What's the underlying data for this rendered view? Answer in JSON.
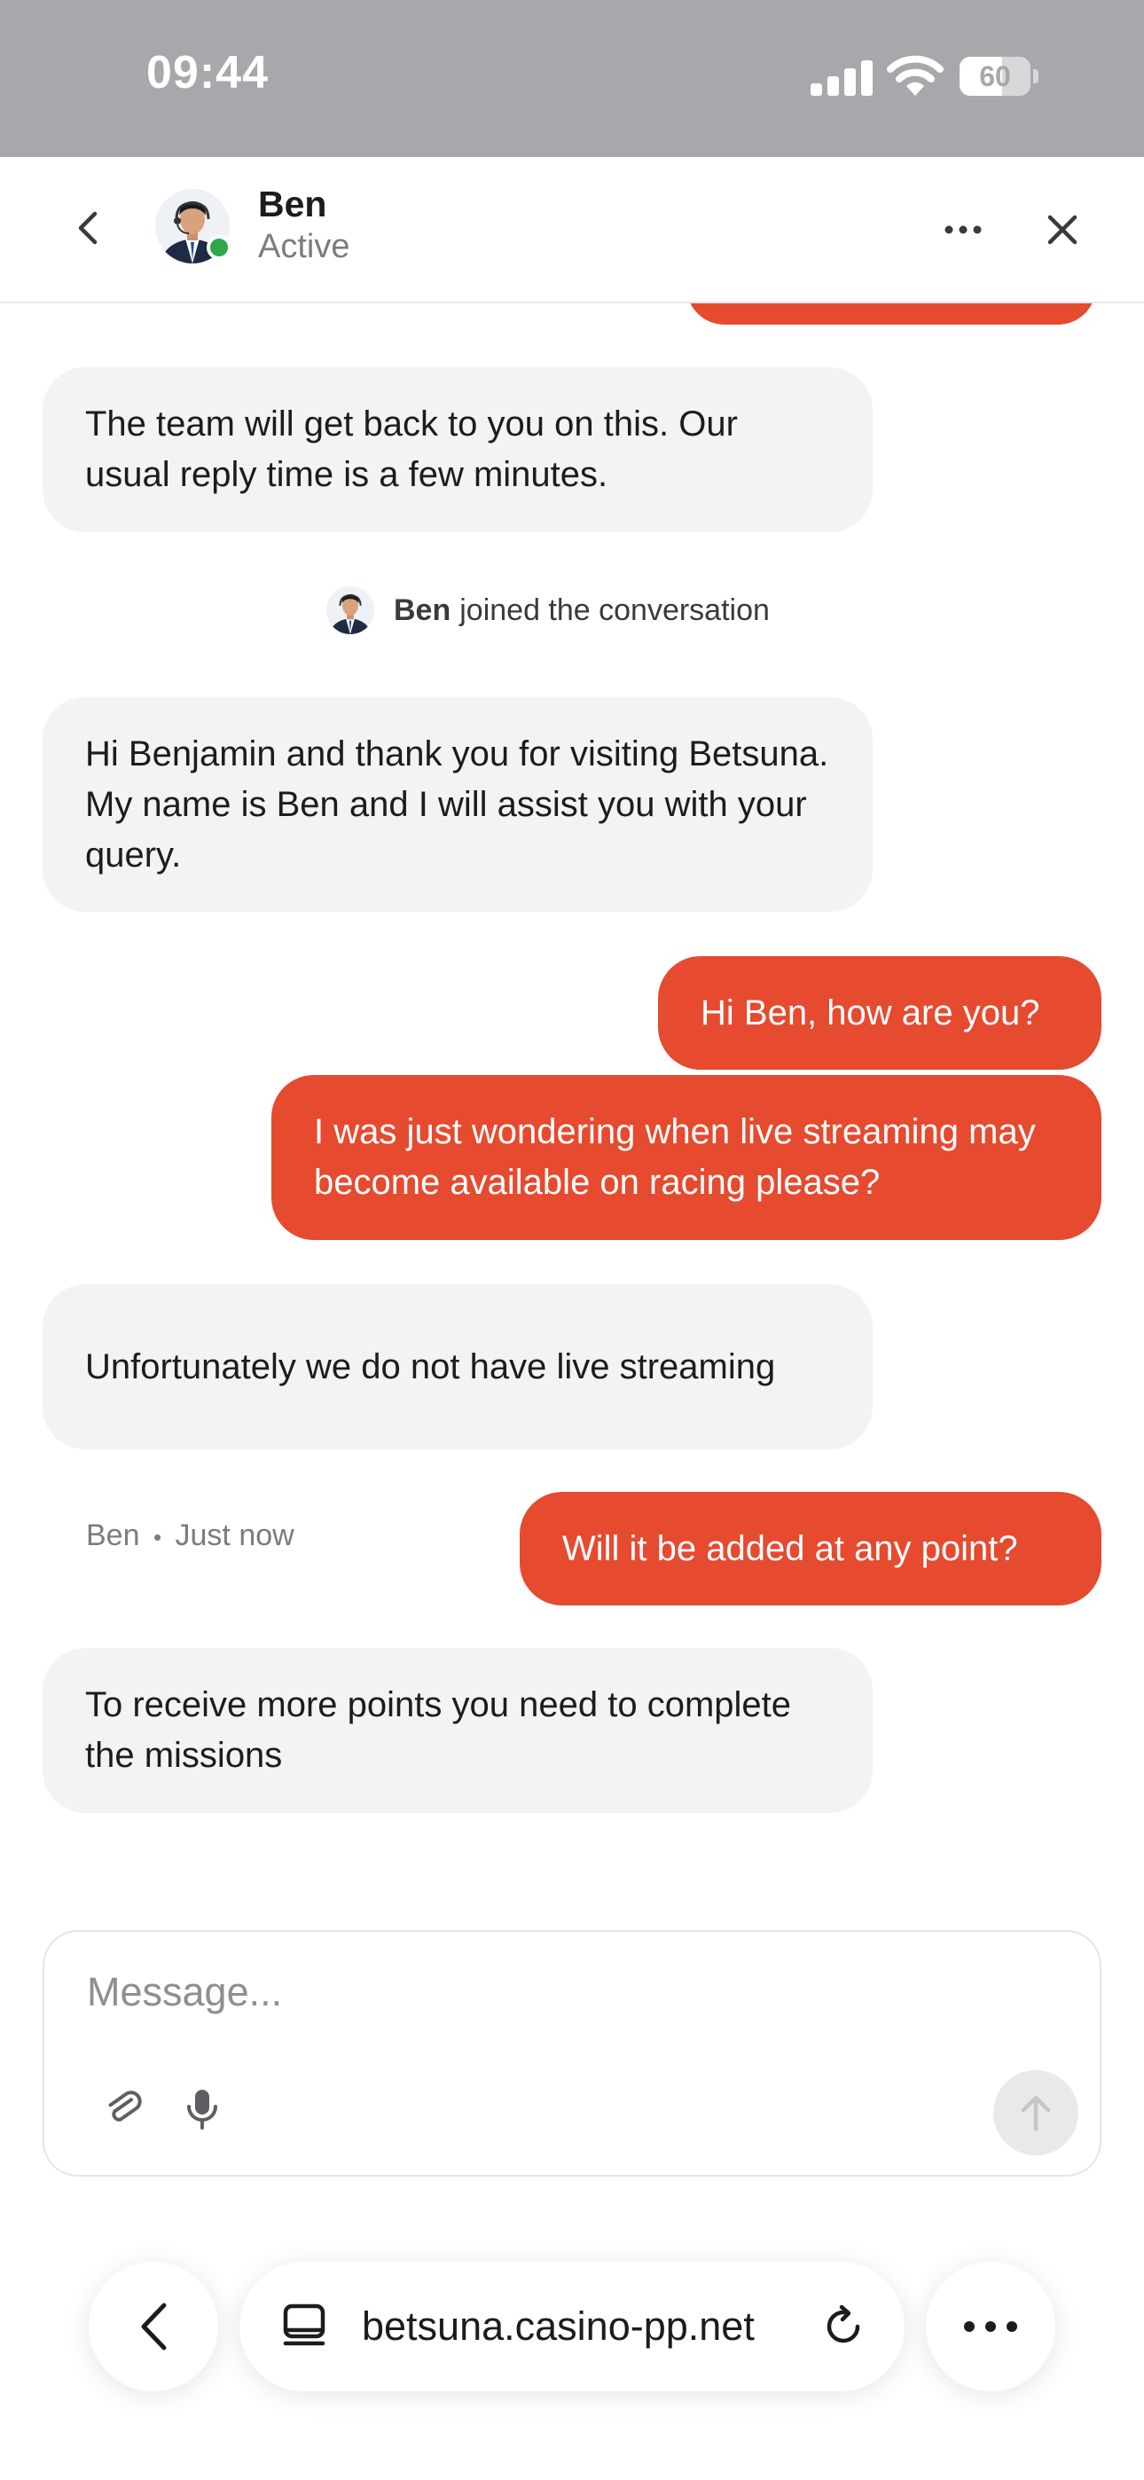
{
  "status_bar": {
    "time": "09:44",
    "battery_level": "60",
    "battery_fraction": 0.6
  },
  "header": {
    "agent_name": "Ben",
    "agent_status": "Active",
    "icons": [
      "chevron-left-icon",
      "avatar",
      "more-horizontal-icon",
      "close-icon"
    ],
    "online_color": "#2ea84a"
  },
  "messages": [
    {
      "from": "agent",
      "text": "The team will get back to you on this. Our usual reply time is a few minutes."
    },
    {
      "from": "system",
      "name": "Ben",
      "text": "joined the conversation"
    },
    {
      "from": "agent",
      "text": "Hi Benjamin and thank you for visiting Betsuna. My name is Ben and I will assist you with your query."
    },
    {
      "from": "user",
      "text": "Hi Ben, how are you?"
    },
    {
      "from": "user",
      "text": "I was just wondering when live streaming may become available on racing please?"
    },
    {
      "from": "agent",
      "text": "Unfortunately we do not have live streaming"
    },
    {
      "from": "user",
      "text": "Will it be added at any point?"
    },
    {
      "from": "agent",
      "text": "To receive more points you need to complete the missions"
    }
  ],
  "last_meta": {
    "author": "Ben",
    "separator": "•",
    "time": "Just now"
  },
  "composer": {
    "placeholder": "Message...",
    "icons": [
      "paperclip-icon",
      "microphone-icon",
      "arrow-up-icon"
    ]
  },
  "browser": {
    "url": "betsuna.casino-pp.net",
    "icons": [
      "chevron-left-icon",
      "tab-icon",
      "reload-icon",
      "more-horizontal-icon"
    ]
  },
  "colors": {
    "accent": "#e64a2f",
    "agent_bubble": "#f3f3f3",
    "status_bar": "#a8a7ab"
  }
}
